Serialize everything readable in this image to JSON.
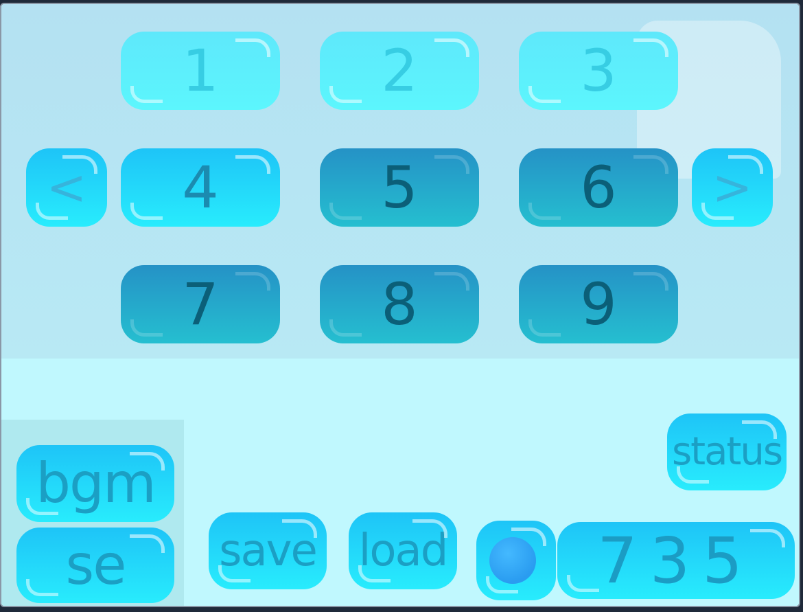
{
  "grid": {
    "buttons": [
      {
        "label": "1",
        "state": "inactive"
      },
      {
        "label": "2",
        "state": "inactive"
      },
      {
        "label": "3",
        "state": "inactive"
      },
      {
        "label": "4",
        "state": "current"
      },
      {
        "label": "5",
        "state": "selected"
      },
      {
        "label": "6",
        "state": "selected"
      },
      {
        "label": "7",
        "state": "selected"
      },
      {
        "label": "8",
        "state": "selected"
      },
      {
        "label": "9",
        "state": "selected"
      }
    ],
    "prev_label": "<",
    "next_label": ">"
  },
  "side": {
    "bgm_label": "bgm",
    "se_label": "se"
  },
  "actions": {
    "save_label": "save",
    "load_label": "load",
    "status_label": "status"
  },
  "score": {
    "value": "735",
    "orb_icon": "blue-orb-icon"
  },
  "colors": {
    "light_button": "#5ef2fc",
    "bright_button": "#22d8fa",
    "dark_button": "#2592c6",
    "upper_background": "#b6e5f3",
    "lower_background": "#c0f8fe"
  }
}
